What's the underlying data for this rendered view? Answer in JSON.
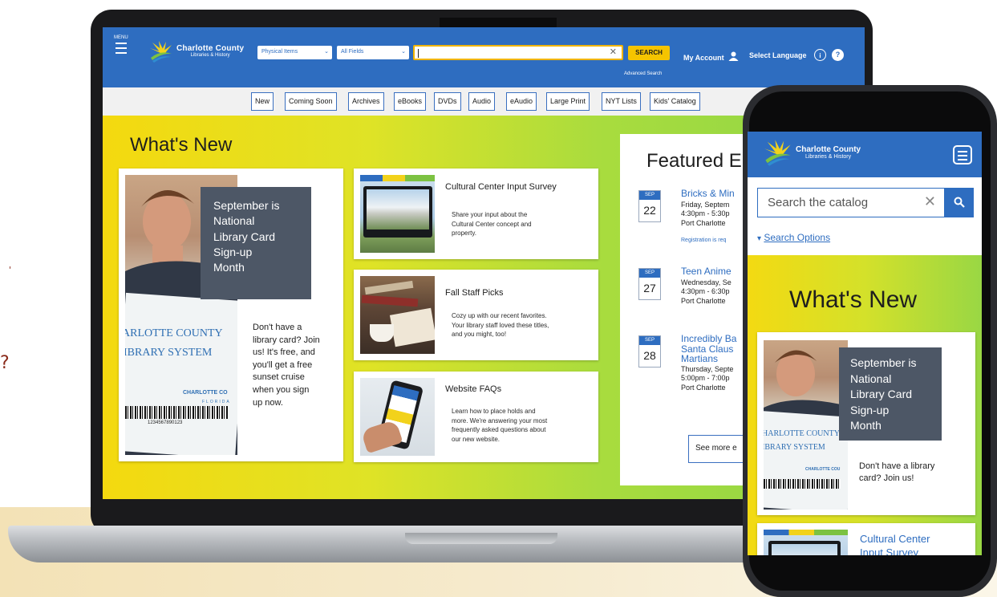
{
  "page_edge": {
    "char_a": "'",
    "char_b": "?"
  },
  "laptop": {
    "header": {
      "menu_label": "MENU",
      "logo_line1": "Charlotte County",
      "logo_line2": "Libraries & History",
      "scope_select": "Physical Items",
      "field_select": "All Fields",
      "search_value": "",
      "search_button": "SEARCH",
      "advanced_search": "Advanced Search",
      "my_account": "My Account",
      "select_language": "Select Language"
    },
    "nav": [
      "New",
      "Coming Soon",
      "Archives",
      "eBooks",
      "DVDs",
      "Audio",
      "eAudio",
      "Large Print",
      "NYT Lists",
      "Kids' Catalog"
    ],
    "whats_new": {
      "title": "What's New",
      "promo_overlay": [
        "September is",
        "National",
        "Library Card",
        "Sign-up",
        "Month"
      ],
      "promo_text": [
        "Don't have a",
        "library card? Join",
        "us! It's free, and",
        "you'll get a free",
        "sunset cruise",
        "when you sign",
        "up now."
      ],
      "card_photo_text": {
        "line1": "ARLOTTE COUNTY",
        "line2": "IBRARY SYSTEM",
        "logo": "CHARLOTTE CO",
        "sub": "FLORIDA",
        "barcode_number": "1234567890123"
      },
      "cards": [
        {
          "title": "Cultural Center Input Survey",
          "desc": [
            "Share your input about the",
            "Cultural Center concept and",
            "property."
          ]
        },
        {
          "title": "Fall Staff Picks",
          "desc": [
            "Cozy up with our recent favorites.",
            "Your library staff loved these titles,",
            "and you might, too!"
          ]
        },
        {
          "title": "Website FAQs",
          "desc": [
            "Learn how to place holds and",
            "more. We're answering your most",
            "frequently asked questions about",
            "our new website."
          ]
        }
      ]
    },
    "featured": {
      "title": "Featured E",
      "events": [
        {
          "month": "SEP",
          "day": "22",
          "title": [
            "Bricks & Min"
          ],
          "meta": [
            "Friday, Septem",
            "4:30pm - 5:30p",
            "Port Charlotte"
          ],
          "note": "Registration is req"
        },
        {
          "month": "SEP",
          "day": "27",
          "title": [
            "Teen Anime"
          ],
          "meta": [
            "Wednesday, Se",
            "4:30pm - 6:30p",
            "Port Charlotte"
          ],
          "note": ""
        },
        {
          "month": "SEP",
          "day": "28",
          "title": [
            "Incredibly Ba",
            "Santa Claus",
            "Martians"
          ],
          "meta": [
            "Thursday, Septe",
            "5:00pm - 7:00p",
            "Port Charlotte"
          ],
          "note": ""
        }
      ],
      "see_more": "See more e"
    }
  },
  "phone": {
    "logo_line1": "Charlotte County",
    "logo_line2": "Libraries & History",
    "search_placeholder": "Search the catalog",
    "search_options": "Search Options",
    "whats_new_title": "What's New",
    "promo_overlay": [
      "September is",
      "National",
      "Library Card",
      "Sign-up",
      "Month"
    ],
    "promo_text": [
      "Don't have a library",
      "card? Join us!"
    ],
    "card_photo_text": {
      "line1": "HARLOTTE COUNTY",
      "line2": "IBRARY SYSTEM",
      "logo": "CHARLOTTE COU"
    },
    "next_card_title": [
      "Cultural Center",
      "Input Survey"
    ]
  },
  "colors": {
    "brand_blue": "#2e6dc0",
    "search_yellow": "#f5c400",
    "overlay_slate": "#4d5766"
  },
  "icons": [
    "hamburger-icon",
    "sunburst-logo-icon",
    "chevron-down-icon",
    "clear-icon",
    "account-icon",
    "accessibility-icon",
    "help-icon",
    "search-icon"
  ]
}
